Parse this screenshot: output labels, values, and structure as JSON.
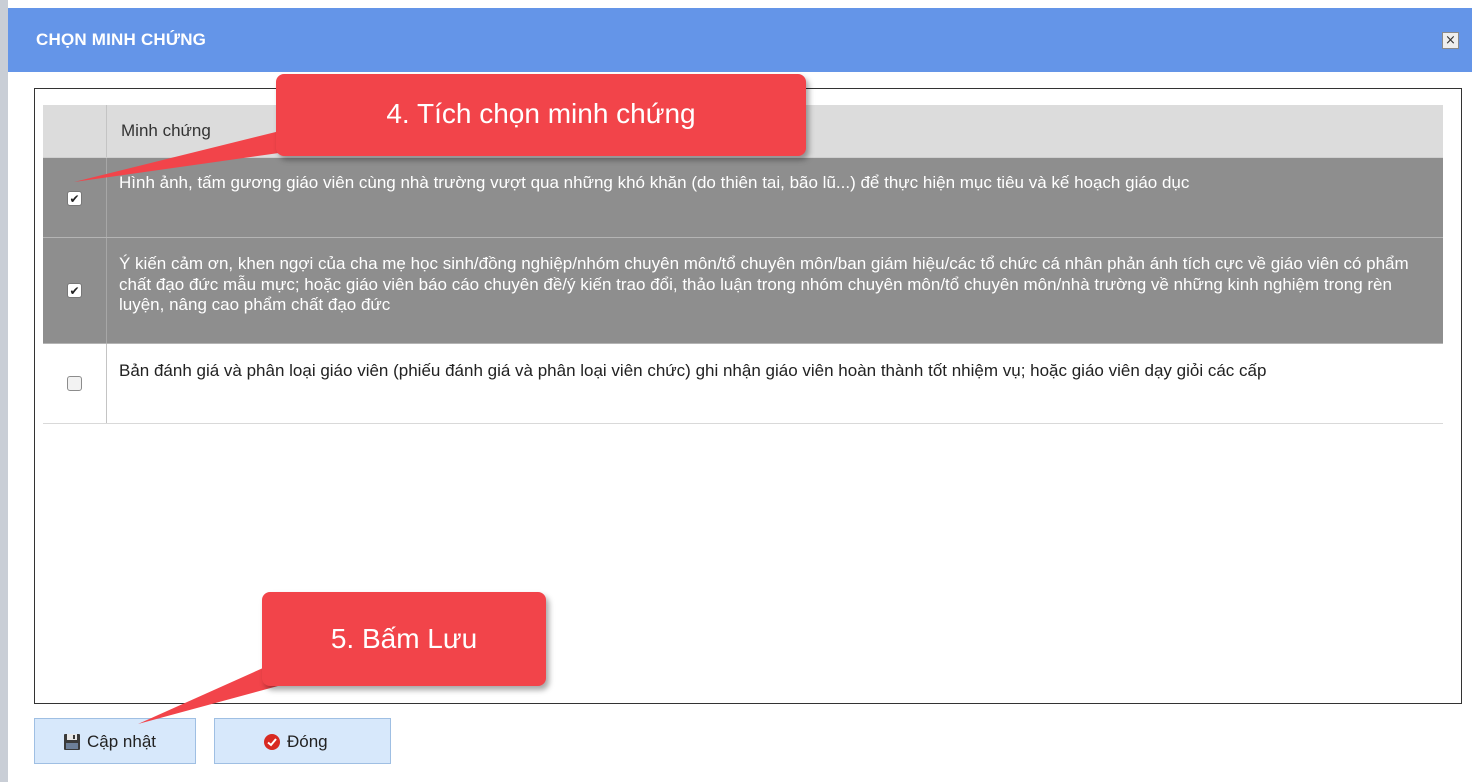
{
  "dialog": {
    "title": "CHỌN MINH CHỨNG",
    "close_icon": "close-icon",
    "close_glyph": "×"
  },
  "grid": {
    "header": "Minh chứng",
    "rows": [
      {
        "checked": true,
        "text": "Hình ảnh, tấm gương giáo viên cùng nhà trường vượt qua những khó khăn (do thiên tai, bão lũ...) để thực hiện mục tiêu và kế hoạch giáo dục"
      },
      {
        "checked": true,
        "text": "Ý kiến cảm ơn, khen ngợi của cha mẹ học sinh/đồng nghiệp/nhóm chuyên môn/tổ chuyên môn/ban giám hiệu/các tổ chức cá nhân phản ánh tích cực về giáo viên có phẩm chất đạo đức mẫu mực; hoặc giáo viên báo cáo chuyên đề/ý kiến trao đổi, thảo luận trong nhóm chuyên môn/tổ chuyên môn/nhà trường về những kinh nghiệm trong rèn luyện, nâng cao phẩm chất đạo đức"
      },
      {
        "checked": false,
        "text": "Bản đánh giá và phân loại giáo viên (phiếu đánh giá và phân loại viên chức) ghi nhận giáo viên hoàn thành tốt nhiệm vụ; hoặc giáo viên dạy giỏi các cấp"
      }
    ],
    "check_glyph": "✔"
  },
  "footer": {
    "update_label": "Cập nhật",
    "update_icon": "save-icon",
    "close_label": "Đóng",
    "close_icon": "stop-icon"
  },
  "annotations": {
    "step4": "4. Tích chọn minh chứng",
    "step5": "5. Bấm Lưu"
  },
  "colors": {
    "titlebar": "#6495e8",
    "selected_row": "#8e8e8e",
    "callout": "#f2444a",
    "button": "#d7e8fb"
  }
}
